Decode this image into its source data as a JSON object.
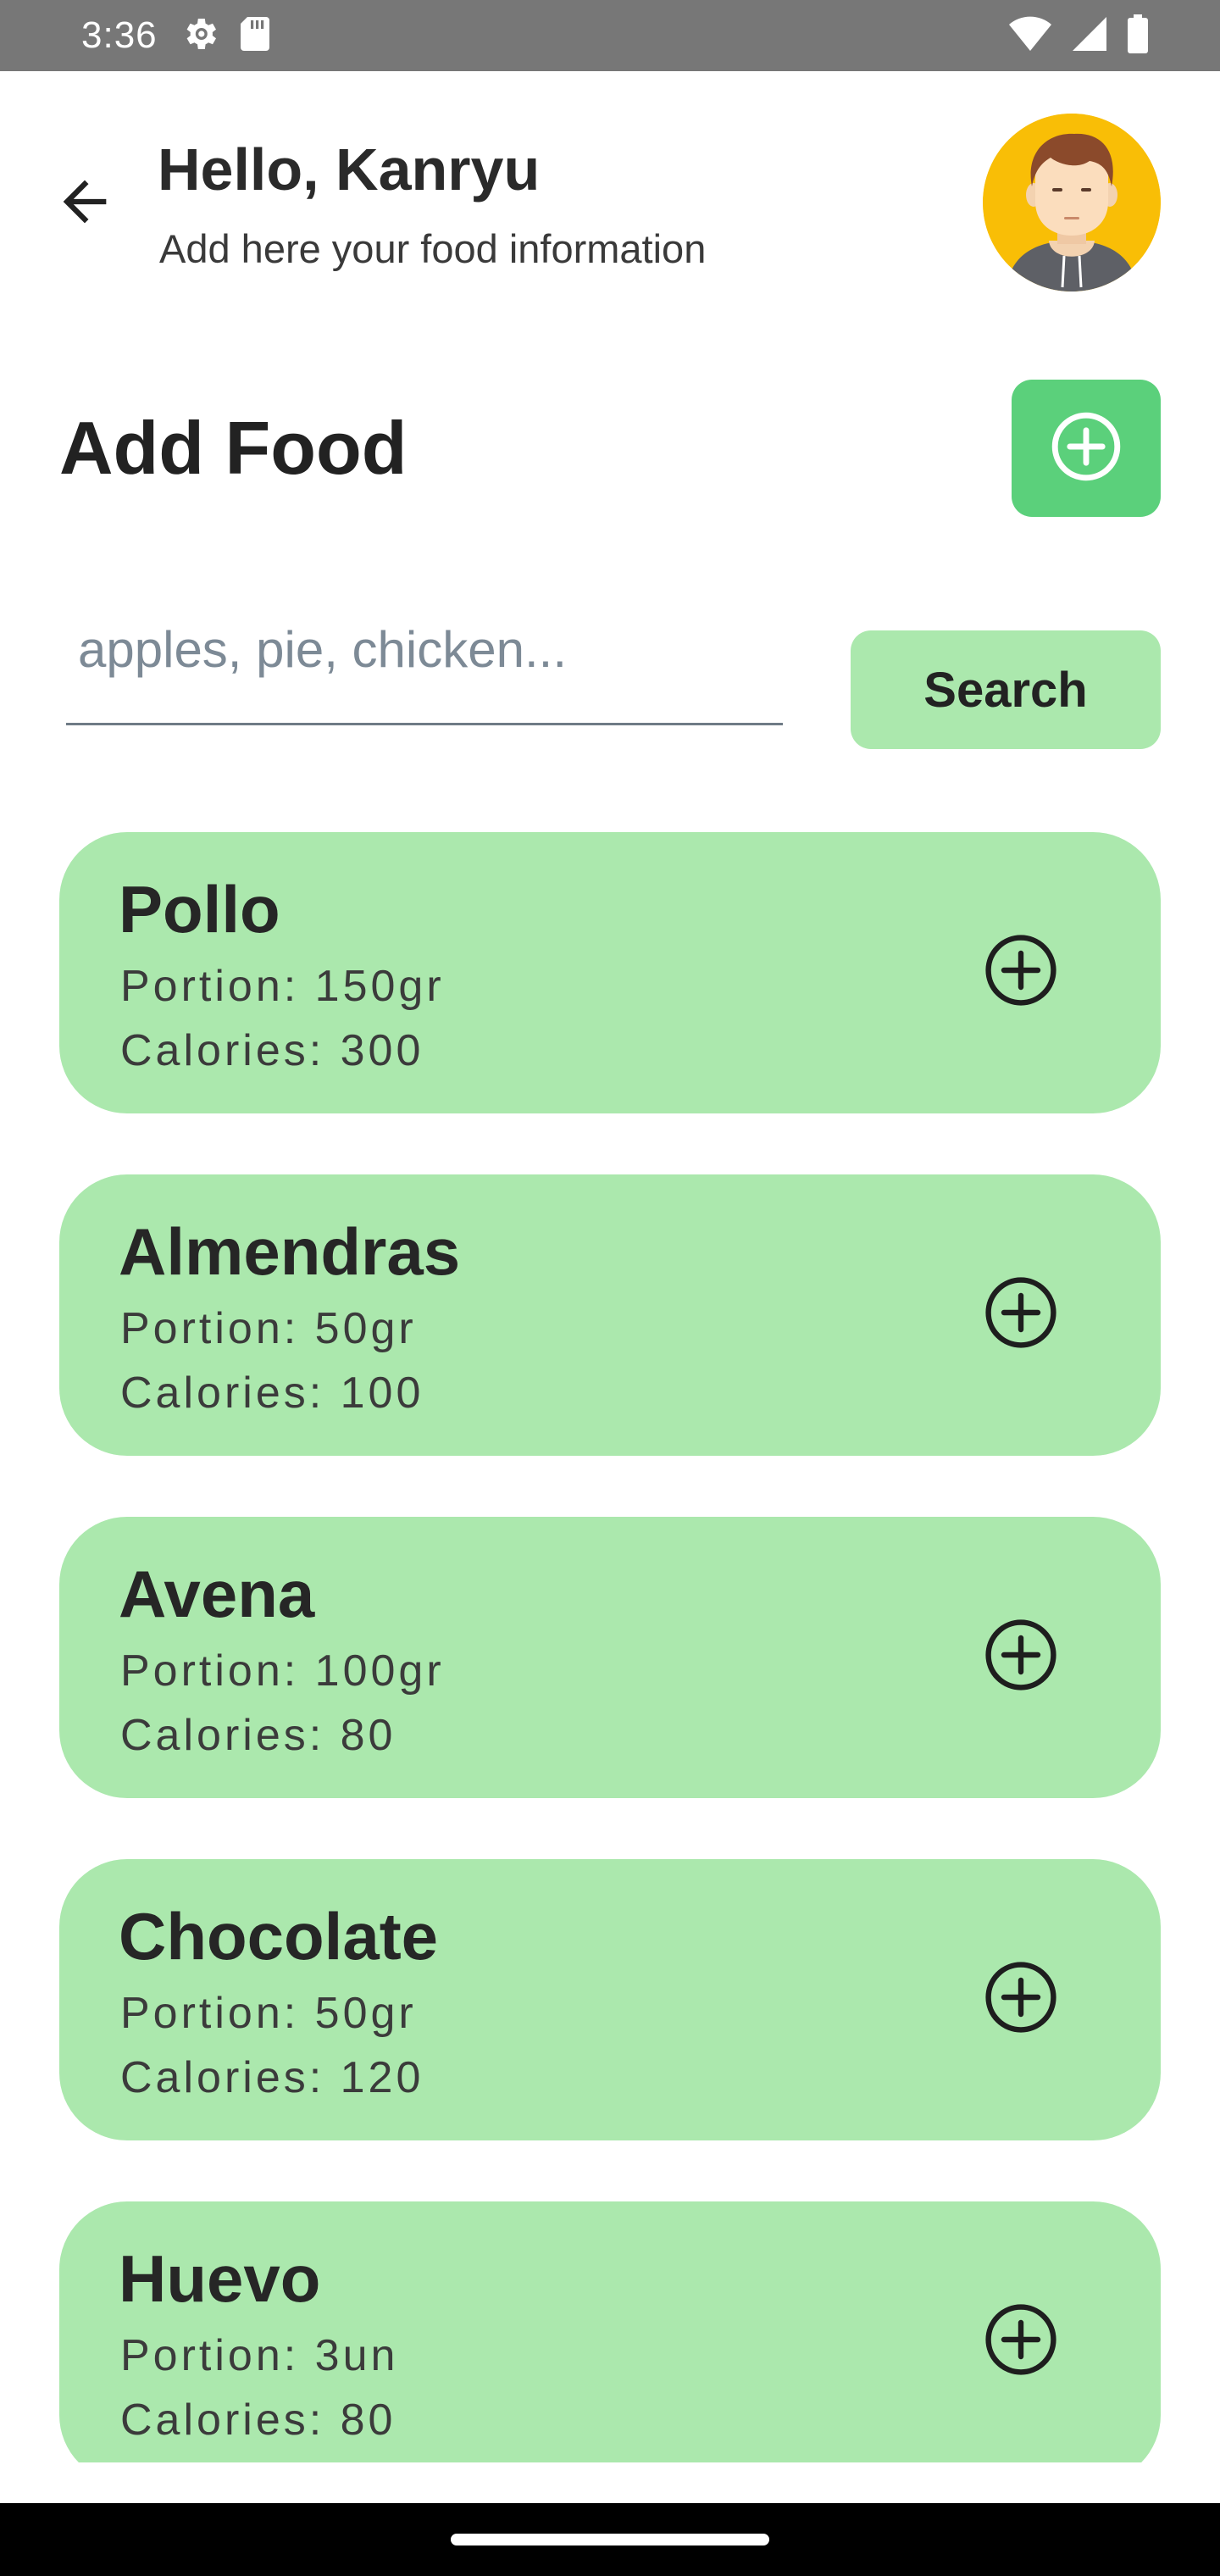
{
  "status_bar": {
    "time": "3:36",
    "icons": [
      "settings-gear-icon",
      "sd-card-icon",
      "wifi-icon",
      "cellular-signal-icon",
      "battery-icon"
    ]
  },
  "header": {
    "greeting": "Hello, Kanryu",
    "subtitle": "Add here your food information",
    "back_icon": "arrow-back-icon",
    "avatar_icon": "user-avatar"
  },
  "add_food": {
    "title": "Add Food",
    "button_icon": "plus-circle-icon"
  },
  "search": {
    "placeholder": "apples, pie, chicken...",
    "value": "",
    "button_label": "Search"
  },
  "foods": [
    {
      "name": "Pollo",
      "portion_label": "Portion: ",
      "portion": "150gr",
      "calories_label": "Calories: ",
      "calories": "300"
    },
    {
      "name": "Almendras",
      "portion_label": "Portion: ",
      "portion": "50gr",
      "calories_label": "Calories: ",
      "calories": "100"
    },
    {
      "name": "Avena",
      "portion_label": "Portion: ",
      "portion": "100gr",
      "calories_label": "Calories: ",
      "calories": "80"
    },
    {
      "name": "Chocolate",
      "portion_label": "Portion: ",
      "portion": "50gr",
      "calories_label": "Calories: ",
      "calories": "120"
    },
    {
      "name": "Huevo",
      "portion_label": "Portion: ",
      "portion": "3un",
      "calories_label": "Calories: ",
      "calories": "80"
    }
  ],
  "colors": {
    "accent_green": "#5BD07B",
    "card_green": "#ABE8AD",
    "avatar_bg": "#F9BE06",
    "status_bar": "#777777"
  }
}
